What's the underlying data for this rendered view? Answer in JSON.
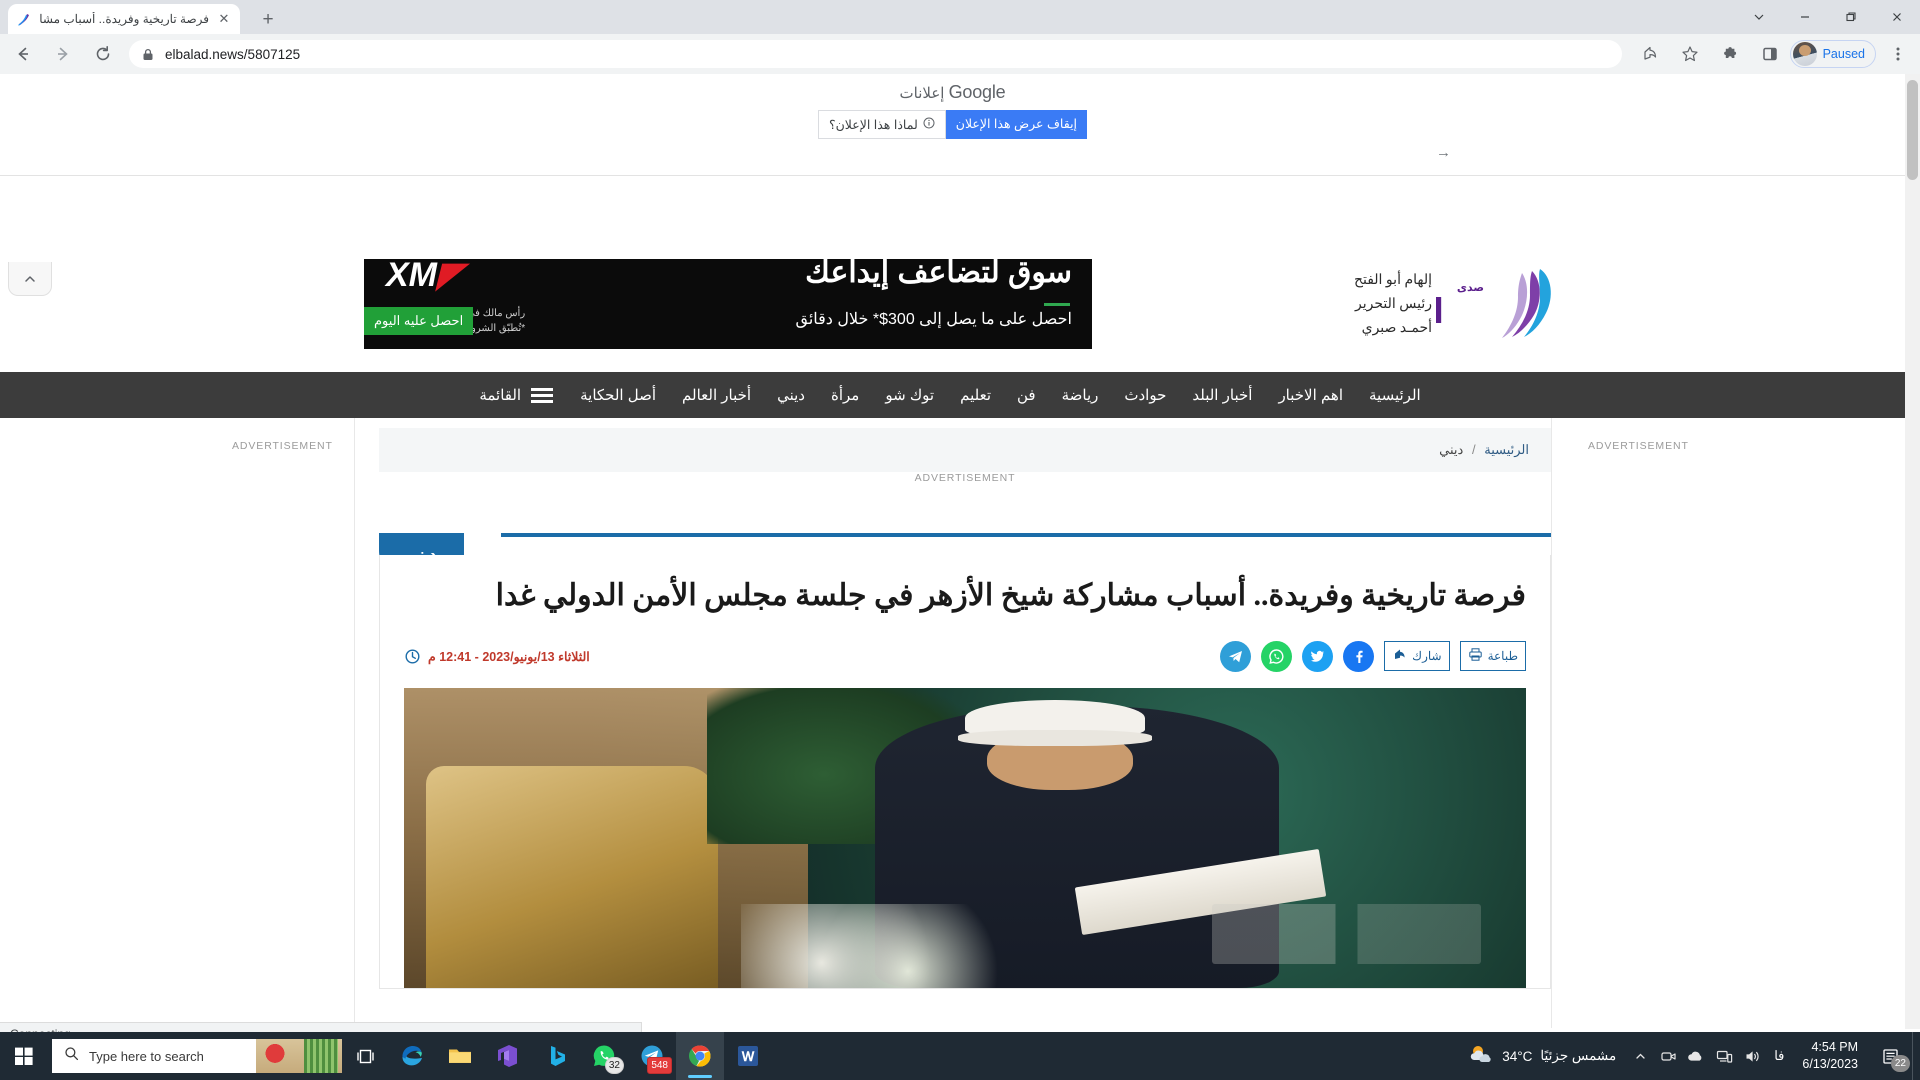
{
  "browser": {
    "tab": {
      "title": "فرصة تاريخية وفريدة.. أسباب مشار",
      "favicon_name": "elbalad-favicon",
      "close_label": "✕"
    },
    "newtab_label": "+",
    "window_controls": {
      "restore_down": "⌄",
      "minimize": "—",
      "maximize": "❐",
      "close": "✕"
    },
    "toolbar": {
      "back": "←",
      "forward": "→",
      "reload": "⟳",
      "url": "elbalad.news/5807125",
      "lock_icon": "lock-icon",
      "share_icon": "share-icon",
      "bookmark_icon": "star-icon",
      "extensions_icon": "puzzle-icon",
      "sidepanel_icon": "side-panel-icon",
      "profile_label": "Paused",
      "menu_icon": "three-dot-menu-icon"
    }
  },
  "google_ads": {
    "label_prefix": "إعلانات",
    "label_brand": "Google",
    "stop_button": "إيقاف عرض هذا الإعلان",
    "why_button": "لماذا هذا الإعلان؟",
    "info_icon": "info-icon",
    "arrow": "→",
    "collapse_icon": "chevron-up-icon"
  },
  "banner_ad": {
    "headline": "سوق لتضاعف إيداعك",
    "subline": "احصل على ما يصل إلى 300$* خلال دقائق",
    "logo": "XM",
    "terms_line1": "رأس مالك في خطر.",
    "terms_line2": "*تُطبّق الشروط والأحكام.",
    "cta": "احصل عليه اليوم"
  },
  "masthead": {
    "logo_text": "صدى البلد",
    "credits": [
      "إلهام أبو الفتح",
      "رئيس التحرير",
      "أحمـد صبري"
    ]
  },
  "nav": {
    "menu_label": "القائمة",
    "burger_icon": "hamburger-menu-icon",
    "items": [
      "الرئيسية",
      "اهم الاخبار",
      "أخبار البلد",
      "حوادث",
      "رياضة",
      "فن",
      "تعليم",
      "توك شو",
      "مرأة",
      "ديني",
      "أخبار العالم",
      "أصل الحكاية"
    ]
  },
  "ads_labels": {
    "left": "ADVERTISEMENT",
    "right": "ADVERTISEMENT",
    "middle": "ADVERTISEMENT"
  },
  "breadcrumb": {
    "home": "الرئيسية",
    "separator": "/",
    "current": "ديني"
  },
  "article": {
    "category_badge": "ديني",
    "title": "فرصة تاريخية وفريدة.. أسباب مشاركة شيخ الأزهر في جلسة مجلس الأمن الدولي غدا",
    "date": "الثلاثاء 13/يونيو/2023 - 12:41 م",
    "clock_icon": "clock-icon",
    "share": {
      "telegram": "telegram-icon",
      "whatsapp": "whatsapp-icon",
      "twitter": "twitter-icon",
      "facebook": "facebook-icon",
      "share_label": "شارك",
      "print_label": "طباعة"
    },
    "image_alt": "صورة شيخ الأزهر"
  },
  "status_bar": {
    "text": "Connecting..."
  },
  "taskbar": {
    "start_icon": "windows-start-icon",
    "search_placeholder": "Type here to search",
    "search_icon": "search-icon",
    "taskview_icon": "task-view-icon",
    "apps": [
      {
        "name": "microsoft-edge",
        "badge": ""
      },
      {
        "name": "file-explorer",
        "badge": ""
      },
      {
        "name": "microsoft-365",
        "badge": ""
      },
      {
        "name": "bing",
        "badge": ""
      },
      {
        "name": "whatsapp",
        "badge": "32"
      },
      {
        "name": "telegram",
        "badge": "548"
      },
      {
        "name": "google-chrome",
        "badge": ""
      },
      {
        "name": "microsoft-word",
        "badge": ""
      }
    ],
    "tray": {
      "weather_temp": "34°C",
      "weather_condition": "مشمس جزئيًا",
      "weather_icon": "partly-sunny-icon",
      "chevron_icon": "chevron-up-icon",
      "meet_icon": "camera-icon",
      "onedrive_icon": "cloud-icon",
      "network_icon": "network-icon",
      "volume_icon": "volume-icon",
      "language": "فا",
      "time": "4:54 PM",
      "date": "6/13/2023",
      "action_center_icon": "action-center-icon",
      "notification_count": "22"
    }
  },
  "colors": {
    "nav_bg": "#3c3c3c",
    "accent_blue": "#1b6ca8",
    "date_red": "#c0392b",
    "chrome_tabstrip": "#dee1e6",
    "chrome_toolbar": "#f1f3f4",
    "taskbar_bg": "#1f2a34",
    "ad_green": "#21a038",
    "google_blue": "#3a7bf5"
  }
}
